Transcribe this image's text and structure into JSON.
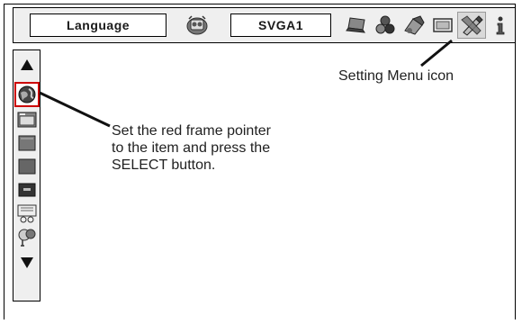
{
  "menubar": {
    "language_label": "Language",
    "source_label": "SVGA1",
    "icons": [
      "input-source-icon",
      "display-icon",
      "color-adjust-icon",
      "image-adjust-icon",
      "screen-icon",
      "setting-icon",
      "information-icon"
    ]
  },
  "sidebar": {
    "items": [
      "scroll-up-arrow",
      "language-icon",
      "auto-setup-icon",
      "background-icon",
      "display-icon",
      "logo-icon",
      "ceiling-icon",
      "lamp-control-icon",
      "scroll-down-arrow"
    ]
  },
  "annotations": {
    "setting_menu_icon": "Setting Menu icon",
    "pointer_line1": "Set the red frame pointer",
    "pointer_line2": "to the item and press the",
    "pointer_line3": "SELECT button."
  },
  "colors": {
    "selection_frame": "#cc0000"
  }
}
